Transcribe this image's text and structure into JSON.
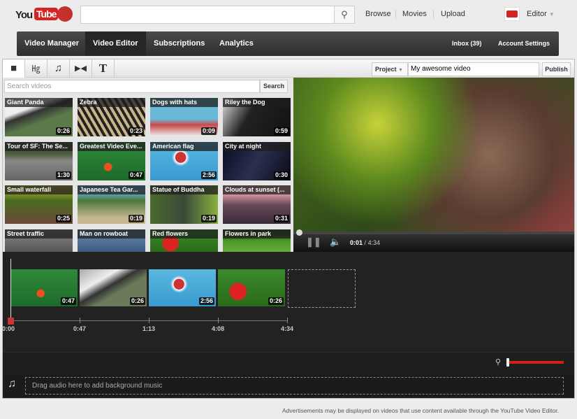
{
  "header": {
    "logo": "YouTube",
    "search_placeholder": "",
    "links": [
      "Browse",
      "Movies",
      "Upload"
    ],
    "user": "Editor"
  },
  "nav": {
    "tabs": [
      "Video Manager",
      "Video Editor",
      "Subscriptions",
      "Analytics"
    ],
    "active": "Video Editor",
    "right": [
      "Inbox (39)",
      "Account Settings"
    ]
  },
  "toolbar": {
    "tools": [
      "video-camera-icon",
      "cc-icon",
      "music-note-icon",
      "transition-icon",
      "text-icon"
    ],
    "project_label": "Project",
    "project_name": "My awesome video",
    "publish": "Publish"
  },
  "library": {
    "search_placeholder": "Search videos",
    "search_button": "Search",
    "videos": [
      {
        "title": "Giant Panda",
        "duration": "0:26"
      },
      {
        "title": "Zebra",
        "duration": "0:23"
      },
      {
        "title": "Dogs with hats",
        "duration": "0:09"
      },
      {
        "title": "Riley the Dog",
        "duration": "0:59"
      },
      {
        "title": "Tour of SF: The Se...",
        "duration": "1:30"
      },
      {
        "title": "Greatest Video Eve...",
        "duration": "0:47"
      },
      {
        "title": "American flag",
        "duration": "2:56"
      },
      {
        "title": "City at night",
        "duration": "0:30"
      },
      {
        "title": "Small waterfall",
        "duration": "0:25"
      },
      {
        "title": "Japanese Tea Gar...",
        "duration": "0:19"
      },
      {
        "title": "Statue of Buddha",
        "duration": "0:19"
      },
      {
        "title": "Clouds at sunset (...",
        "duration": "0:31"
      },
      {
        "title": "Street traffic",
        "duration": ""
      },
      {
        "title": "Man on rowboat",
        "duration": ""
      },
      {
        "title": "Red flowers",
        "duration": ""
      },
      {
        "title": "Flowers in park",
        "duration": ""
      }
    ]
  },
  "player": {
    "current": "0:01",
    "total": "4:34",
    "separator": "/"
  },
  "timeline": {
    "clips": [
      "0:47",
      "0:26",
      "2:56",
      "0:26"
    ],
    "ticks": [
      "0:00",
      "0:47",
      "1:13",
      "4:08",
      "4:34"
    ]
  },
  "audio": {
    "placeholder": "Drag audio here to add background music"
  },
  "footer": "Advertisements may be displayed on videos that use content available through the YouTube Video Editor.",
  "colors": {
    "accent": "#d3201a",
    "nav": "#3a3a3a"
  }
}
